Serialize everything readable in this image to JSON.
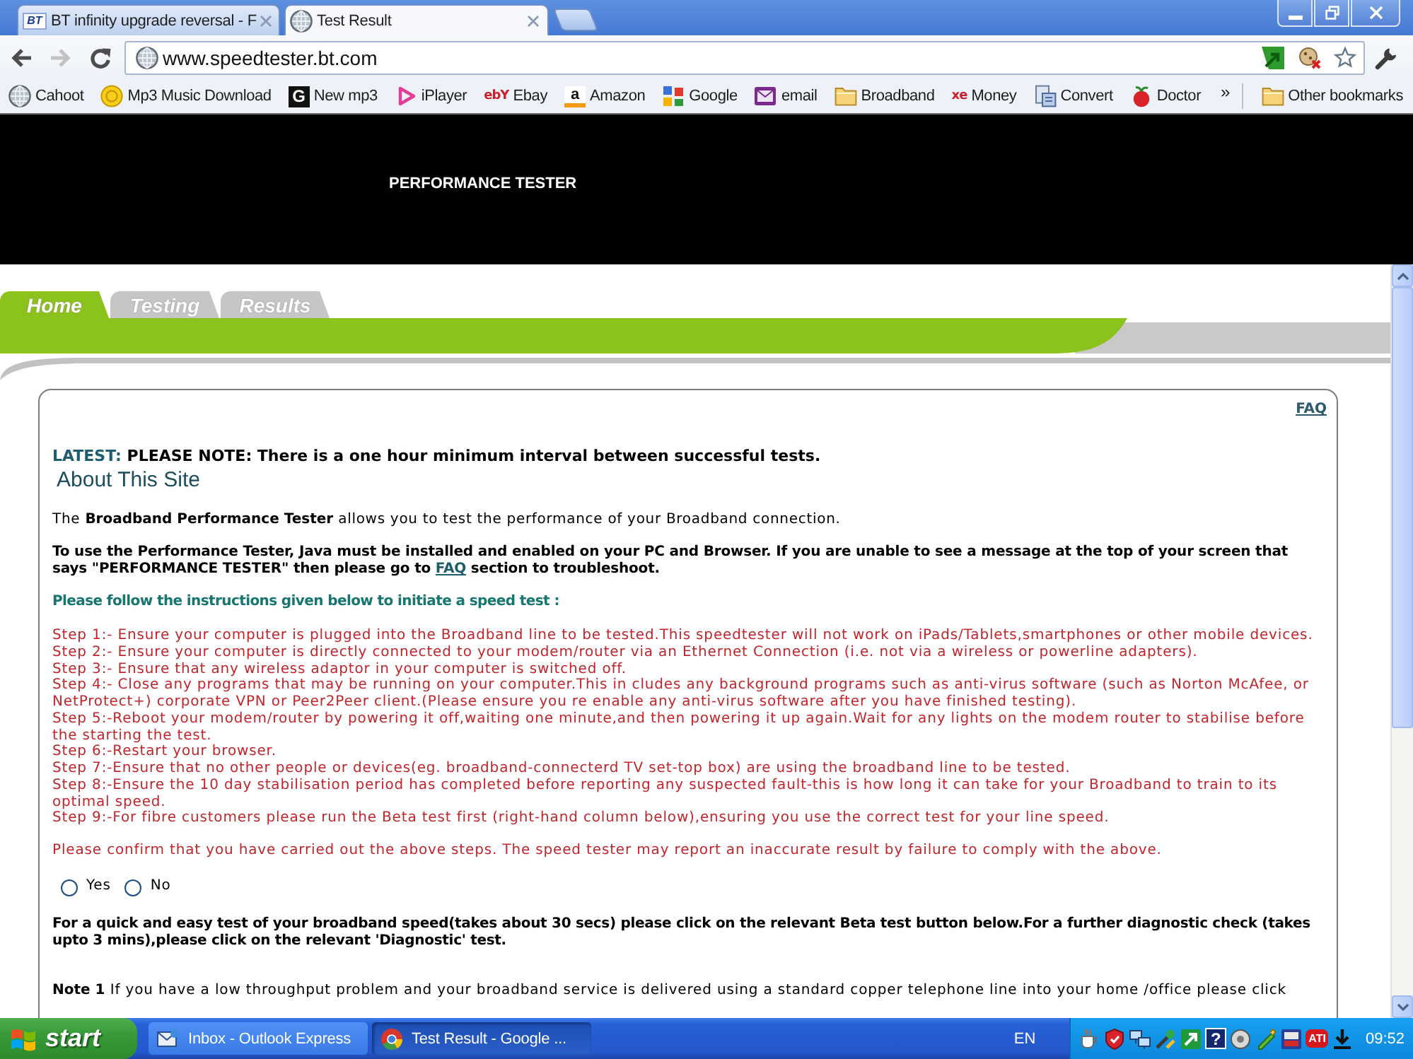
{
  "browser": {
    "tabs": [
      {
        "title": "BT infinity upgrade reversal - F",
        "kind": "letters",
        "icon_text": "BT",
        "selected": false
      },
      {
        "title": "Test Result",
        "kind": "globe",
        "selected": true
      }
    ],
    "address": "www.speedtester.bt.com",
    "bookmarks": [
      {
        "label": "Cahoot",
        "kind": "globe"
      },
      {
        "label": "Mp3 Music Download",
        "kind": "coin"
      },
      {
        "label": "New mp3",
        "kind": "tile",
        "icon_text": "G"
      },
      {
        "label": "iPlayer",
        "kind": "play"
      },
      {
        "label": "Ebay",
        "kind": "wordmark",
        "icon_text": "ebY"
      },
      {
        "label": "Amazon",
        "kind": "letter",
        "icon_text": "a"
      },
      {
        "label": "Google",
        "kind": "squares"
      },
      {
        "label": "email",
        "kind": "envelope"
      },
      {
        "label": "Broadband",
        "kind": "folder"
      },
      {
        "label": "Money",
        "kind": "wordmark",
        "icon_text": "xe"
      },
      {
        "label": "Convert",
        "kind": "document"
      },
      {
        "label": "Doctor",
        "kind": "fruit"
      }
    ],
    "bookmarks_overflow": "»",
    "other_bookmarks": "Other bookmarks"
  },
  "page": {
    "header_title": "PERFORMANCE TESTER",
    "nav_tabs": [
      {
        "label": "Home",
        "selected": true
      },
      {
        "label": "Testing",
        "selected": false
      },
      {
        "label": "Results",
        "selected": false
      }
    ],
    "faq_link": "FAQ",
    "latest": {
      "label": "LATEST:",
      "text": "PLEASE NOTE: There is a one hour minimum interval between successful tests."
    },
    "heading": "About This Site",
    "intro": "The **Broadband Performance Tester** allows you to test the performance of your Broadband connection.",
    "java_note": {
      "before": "To use the Performance Tester, Java must be installed and enabled on your PC and Browser. If you are unable to see a message at the top of your screen that says \"PERFORMANCE TESTER\" then please go to",
      "link": "FAQ",
      "after": "section to troubleshoot."
    },
    "instructions_title": "Please follow the instructions given below to initiate a speed test :",
    "steps": [
      "Step 1:- Ensure your computer is plugged into the Broadband line to be tested.This speedtester will not work on iPads/Tablets,smartphones or other mobile devices.",
      "Step 2:- Ensure your computer is directly connected to your modem/router via an Ethernet Connection (i.e. not via a wireless or powerline adapters).",
      "Step 3:- Ensure that any wireless adaptor in your computer is switched off.",
      "Step 4:- Close any programs that may be running on your computer.This in cludes any background programs such as anti-virus software (such as Norton McAfee, or NetProtect+) corporate VPN or Peer2Peer client.(Please ensure you re enable any anti-virus software after you have finished testing).",
      "Step 5:-Reboot your modem/router by powering it off,waiting one minute,and then powering it up again.Wait for any lights on the modem router to stabilise before the starting the test.",
      "Step 6:-Restart your browser.",
      "Step 7:-Ensure that no other people or devices(eg. broadband-connecterd TV set-top box) are using the broadband line to be tested.",
      "Step 8:-Ensure the 10 day stabilisation period has completed before reporting any suspected fault-this is how long it can take for your Broadband to train to its optimal speed.",
      "Step 9:-For fibre customers please run the Beta test first (right-hand column below),ensuring you use the correct test for your line speed."
    ],
    "confirm": "Please confirm that you have carried out the above steps. The speed tester may report an inaccurate result by failure to comply with the above.",
    "confirm_options": [
      {
        "label": "Yes",
        "selected": false
      },
      {
        "label": "No",
        "selected": false
      }
    ],
    "quick_test_note": "For a quick and easy test of your broadband speed(takes about 30 secs) please click on the relevant Beta test button below.For a further diagnostic check (takes upto 3 mins),please click on the relevant 'Diagnostic' test.",
    "note_1": {
      "label": "Note 1",
      "text": "If you have a low throughput problem and your broadband service is delivered using a standard copper telephone line into your home /office please click"
    }
  },
  "taskbar": {
    "start": "start",
    "tasks": [
      {
        "label": "Inbox - Outlook Express",
        "kind": "mail",
        "selected": false
      },
      {
        "label": "Test Result - Google ...",
        "kind": "browser",
        "selected": true
      }
    ],
    "language": "EN",
    "tray_icons": [
      {
        "kind": "cup"
      },
      {
        "kind": "shield"
      },
      {
        "kind": "monitors"
      },
      {
        "kind": "tools"
      },
      {
        "kind": "arrow"
      },
      {
        "kind": "tile",
        "text": "?"
      },
      {
        "kind": "disc"
      },
      {
        "kind": "pen"
      },
      {
        "kind": "cube"
      },
      {
        "kind": "badge",
        "text": "ATI"
      },
      {
        "kind": "download"
      }
    ],
    "clock": "09:52"
  }
}
